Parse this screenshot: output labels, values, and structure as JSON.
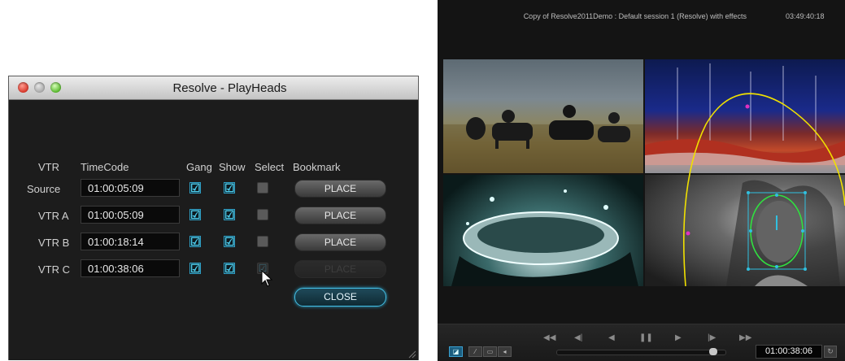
{
  "dialog": {
    "title": "Resolve - PlayHeads",
    "headers": {
      "vtr": "VTR",
      "timecode": "TimeCode",
      "gang": "Gang",
      "show": "Show",
      "select": "Select",
      "bookmark": "Bookmark"
    },
    "rows": [
      {
        "label": "Source",
        "timecode": "01:00:05:09",
        "gang": true,
        "show": true,
        "select": false,
        "place": "PLACE"
      },
      {
        "label": "VTR A",
        "timecode": "01:00:05:09",
        "gang": true,
        "show": true,
        "select": false,
        "place": "PLACE"
      },
      {
        "label": "VTR B",
        "timecode": "01:00:18:14",
        "gang": true,
        "show": true,
        "select": false,
        "place": "PLACE"
      },
      {
        "label": "VTR C",
        "timecode": "01:00:38:06",
        "gang": true,
        "show": true,
        "select": true,
        "place": "PLACE"
      }
    ],
    "close_label": "CLOSE",
    "check_glyph": "☑"
  },
  "viewer": {
    "title": "Copy of Resolve2011Demo : Default session 1 (Resolve) with effects",
    "clock": "03:49:40:18",
    "transport": [
      "◀◀",
      "◀|",
      "◀",
      "❚❚",
      "▶",
      "|▶",
      "▶▶"
    ],
    "timecode": "01:00:38:06",
    "accent_color": "#3aa0d0"
  },
  "colors": {
    "accent": "#2e9ec4",
    "ellipse_yellow": "#f0e000",
    "ellipse_green": "#30e040",
    "box_cyan": "#30c0e0",
    "handle_magenta": "#e030c0"
  }
}
